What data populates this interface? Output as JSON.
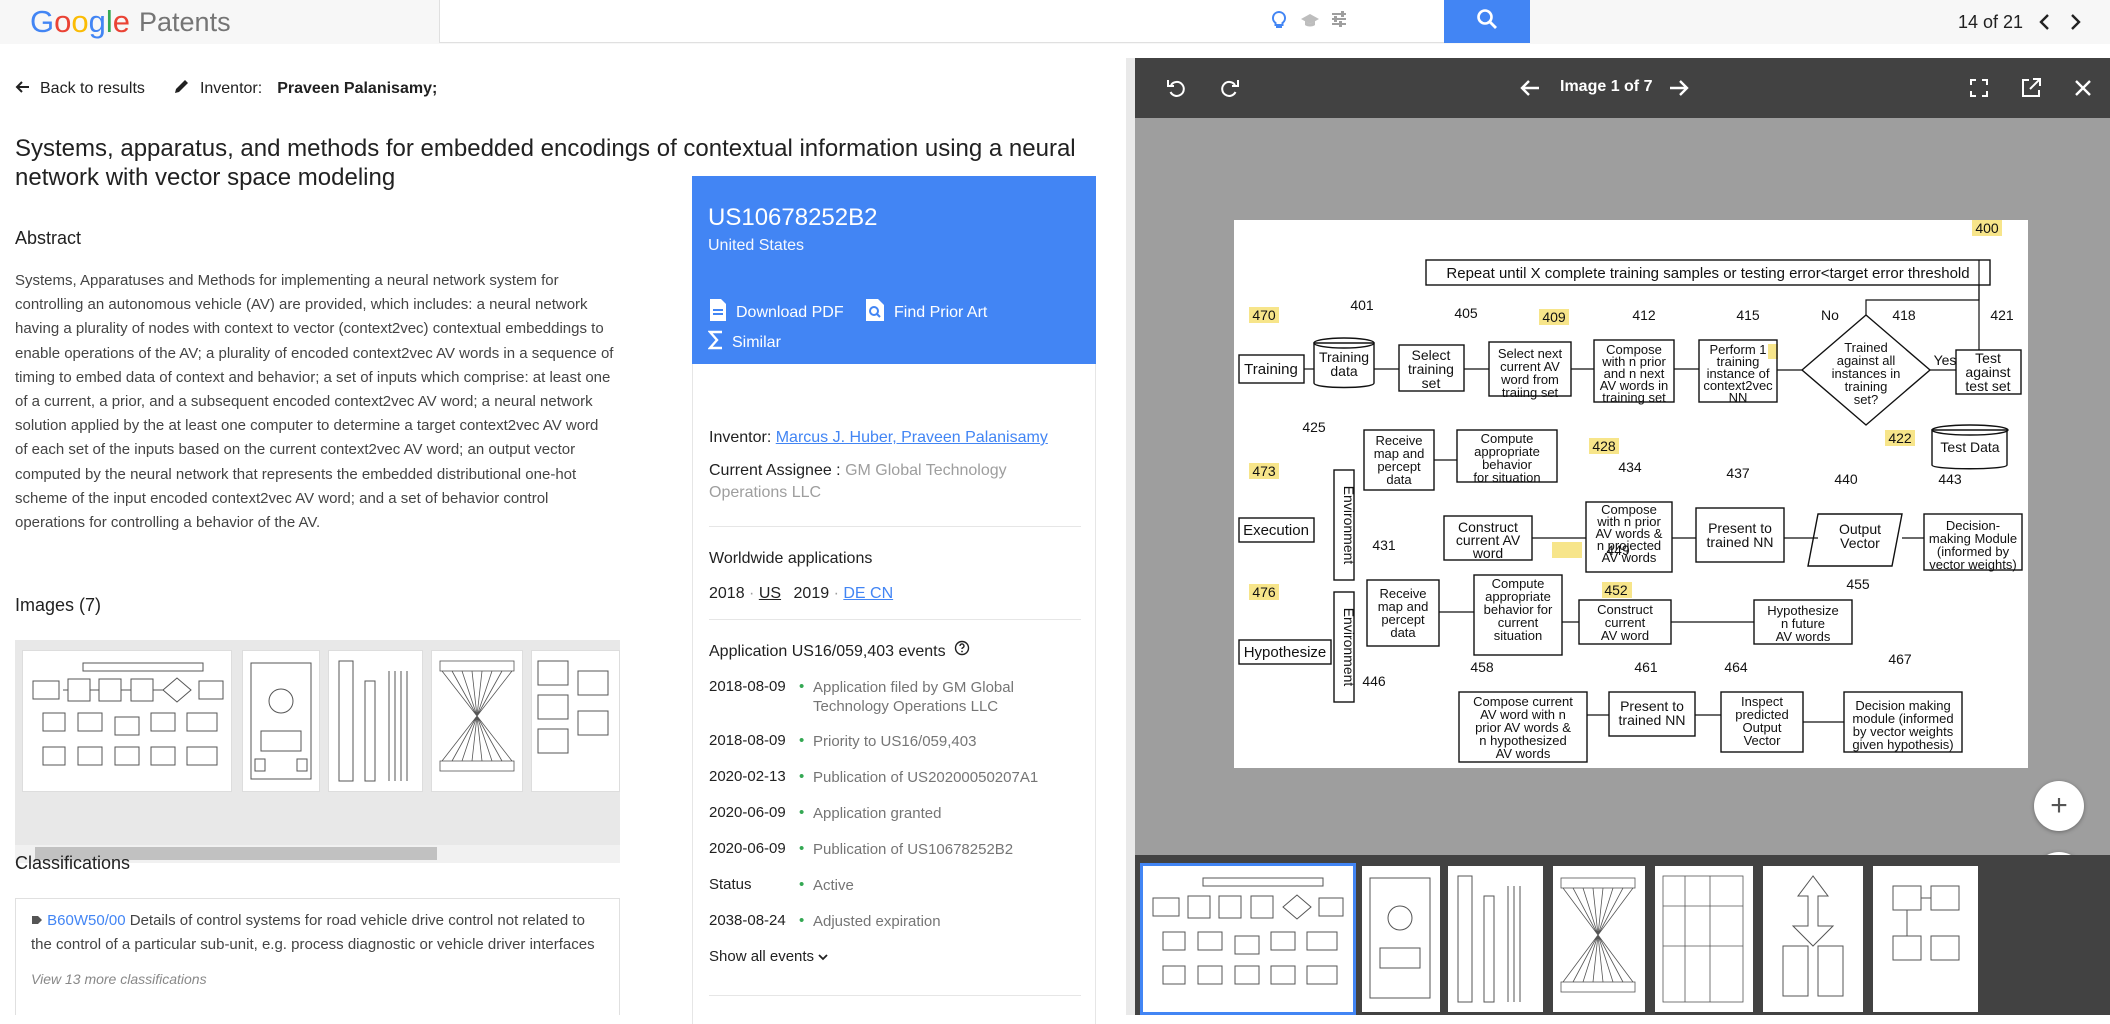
{
  "header": {
    "logo_letters": [
      "G",
      "o",
      "o",
      "g",
      "l",
      "e"
    ],
    "logo_suffix": "Patents",
    "pager_text": "14 of 21"
  },
  "nav": {
    "back_label": "Back to results",
    "inventor_prefix": "Inventor:",
    "inventor_value": "Praveen Palanisamy;"
  },
  "doc": {
    "title": "Systems, apparatus, and methods for embedded encodings of contextual information using a neural network with vector space modeling",
    "abstract_heading": "Abstract",
    "abstract_text": "Systems, Apparatuses and Methods for implementing a neural network system for controlling an autonomous vehicle (AV) are provided, which includes: a neural network having a plurality of nodes with context to vector (context2vec) contextual embeddings to enable operations of the AV; a plurality of encoded context2vec AV words in a sequence of timing to embed data of context and behavior; a set of inputs which comprise: at least one of a current, a prior, and a subsequent encoded context2vec AV word; a neural network solution applied by the at least one computer to determine a target context2vec AV word of each set of the inputs based on the current context2vec AV word; an output vector computed by the neural network that represents the embedded distributional one-hot scheme of the input encoded context2vec AV word; and a set of behavior control operations for controlling a behavior of the AV.",
    "images_heading": "Images (7)",
    "classifications_heading": "Classifications",
    "class_code": "B60W50/00",
    "class_desc": "Details of control systems for road vehicle drive control not related to the control of a particular sub-unit, e.g. process diagnostic or vehicle driver interfaces",
    "more_classifications": "View 13 more classifications"
  },
  "card": {
    "pub_number": "US10678252B2",
    "country": "United States",
    "actions": {
      "download": "Download PDF",
      "prior_art": "Find Prior Art",
      "similar": "Similar"
    },
    "inventor_label": "Inventor:",
    "inventor_names": "Marcus J. Huber, Praveen Palanisamy",
    "assignee_label": "Current Assignee :",
    "assignee_value": "GM Global Technology Operations LLC",
    "worldwide_heading": "Worldwide applications",
    "worldwide": {
      "y1": "2018",
      "c1": "US",
      "y2": "2019",
      "c2": "DE CN"
    },
    "events_heading": "Application US16/059,403 events",
    "events": [
      {
        "date": "2018-08-09",
        "text": "Application filed by GM Global Technology Operations LLC"
      },
      {
        "date": "2018-08-09",
        "text": "Priority to US16/059,403"
      },
      {
        "date": "2020-02-13",
        "text": "Publication of US20200050207A1"
      },
      {
        "date": "2020-06-09",
        "text": "Application granted"
      },
      {
        "date": "2020-06-09",
        "text": "Publication of US10678252B2"
      },
      {
        "date": "Status",
        "text": "Active"
      },
      {
        "date": "2038-08-24",
        "text": "Adjusted expiration"
      }
    ],
    "show_all": "Show all events"
  },
  "viewer": {
    "label": "Image 1 of 7",
    "zoom_in": "+",
    "zoom_out": "−"
  },
  "figure": {
    "texts": {
      "n400": "400",
      "header": "Repeat until X complete training samples or testing error<target error threshold",
      "n470": "470",
      "n401": "401",
      "n405": "405",
      "n409": "409",
      "n412": "412",
      "n415": "415",
      "n418": "418",
      "n421": "421",
      "training": "Training",
      "training_data": [
        "Training",
        "data"
      ],
      "select_set": [
        "Select",
        "training",
        "set"
      ],
      "select_word": [
        "Select next",
        "current AV",
        "word from",
        "traiing set"
      ],
      "compose1": [
        "Compose",
        "with n prior",
        "and n next",
        "AV words in",
        "training set"
      ],
      "perform": [
        "Perform 1",
        "training",
        "instance of",
        "context2vec",
        "NN"
      ],
      "trained_q": [
        "Trained",
        "against all",
        "instances in",
        "training",
        "set?"
      ],
      "no": "No",
      "yes": "Yes",
      "test": [
        "Test",
        "against",
        "test set"
      ],
      "test_data": "Test Data",
      "n425": "425",
      "n428": "428",
      "n422": "422",
      "n434": "434",
      "n437": "437",
      "n440": "440",
      "n443": "443",
      "receive1": [
        "Receive",
        "map and",
        "percept",
        "data"
      ],
      "compute1": [
        "Compute",
        "appropriate",
        "behavior",
        "for situation"
      ],
      "n473": "473",
      "execution": "Execution",
      "environment": "Environment",
      "n431": "431",
      "n449": "449",
      "construct1": [
        "Construct",
        "current AV",
        "word"
      ],
      "compose2": [
        "Compose",
        "with n prior",
        "AV words &",
        "n projected",
        "AV words"
      ],
      "present1": [
        "Present to",
        "trained NN"
      ],
      "output": [
        "Output",
        "Vector"
      ],
      "decision1": [
        "Decision-",
        "making Module",
        "(informed by",
        "vector weights)"
      ],
      "n476": "476",
      "n452": "452",
      "n455": "455",
      "hypothesize": "Hypothesize",
      "receive2": [
        "Receive",
        "map and",
        "percept",
        "data"
      ],
      "compute2": [
        "Compute",
        "appropriate",
        "behavior for",
        "current",
        "situation"
      ],
      "construct2": [
        "Construct",
        "current",
        "AV word"
      ],
      "hypo2": [
        "Hypothesize",
        "n future",
        "AV words"
      ],
      "n446": "446",
      "n458": "458",
      "n461": "461",
      "n464": "464",
      "n467": "467",
      "compose3": [
        "Compose current",
        "AV word with n",
        "prior AV words &",
        "n hypothesized",
        "AV words"
      ],
      "present2": [
        "Present to",
        "trained NN"
      ],
      "inspect": [
        "Inspect",
        "predicted",
        "Output",
        "Vector"
      ],
      "decision2": [
        "Decision making",
        "module (informed",
        "by vector weights",
        "given hypothesis)"
      ]
    }
  },
  "colors": {
    "google_blue": "#4285f4",
    "viewer_dark": "#424242",
    "ref_highlight": "#f7e58a"
  }
}
